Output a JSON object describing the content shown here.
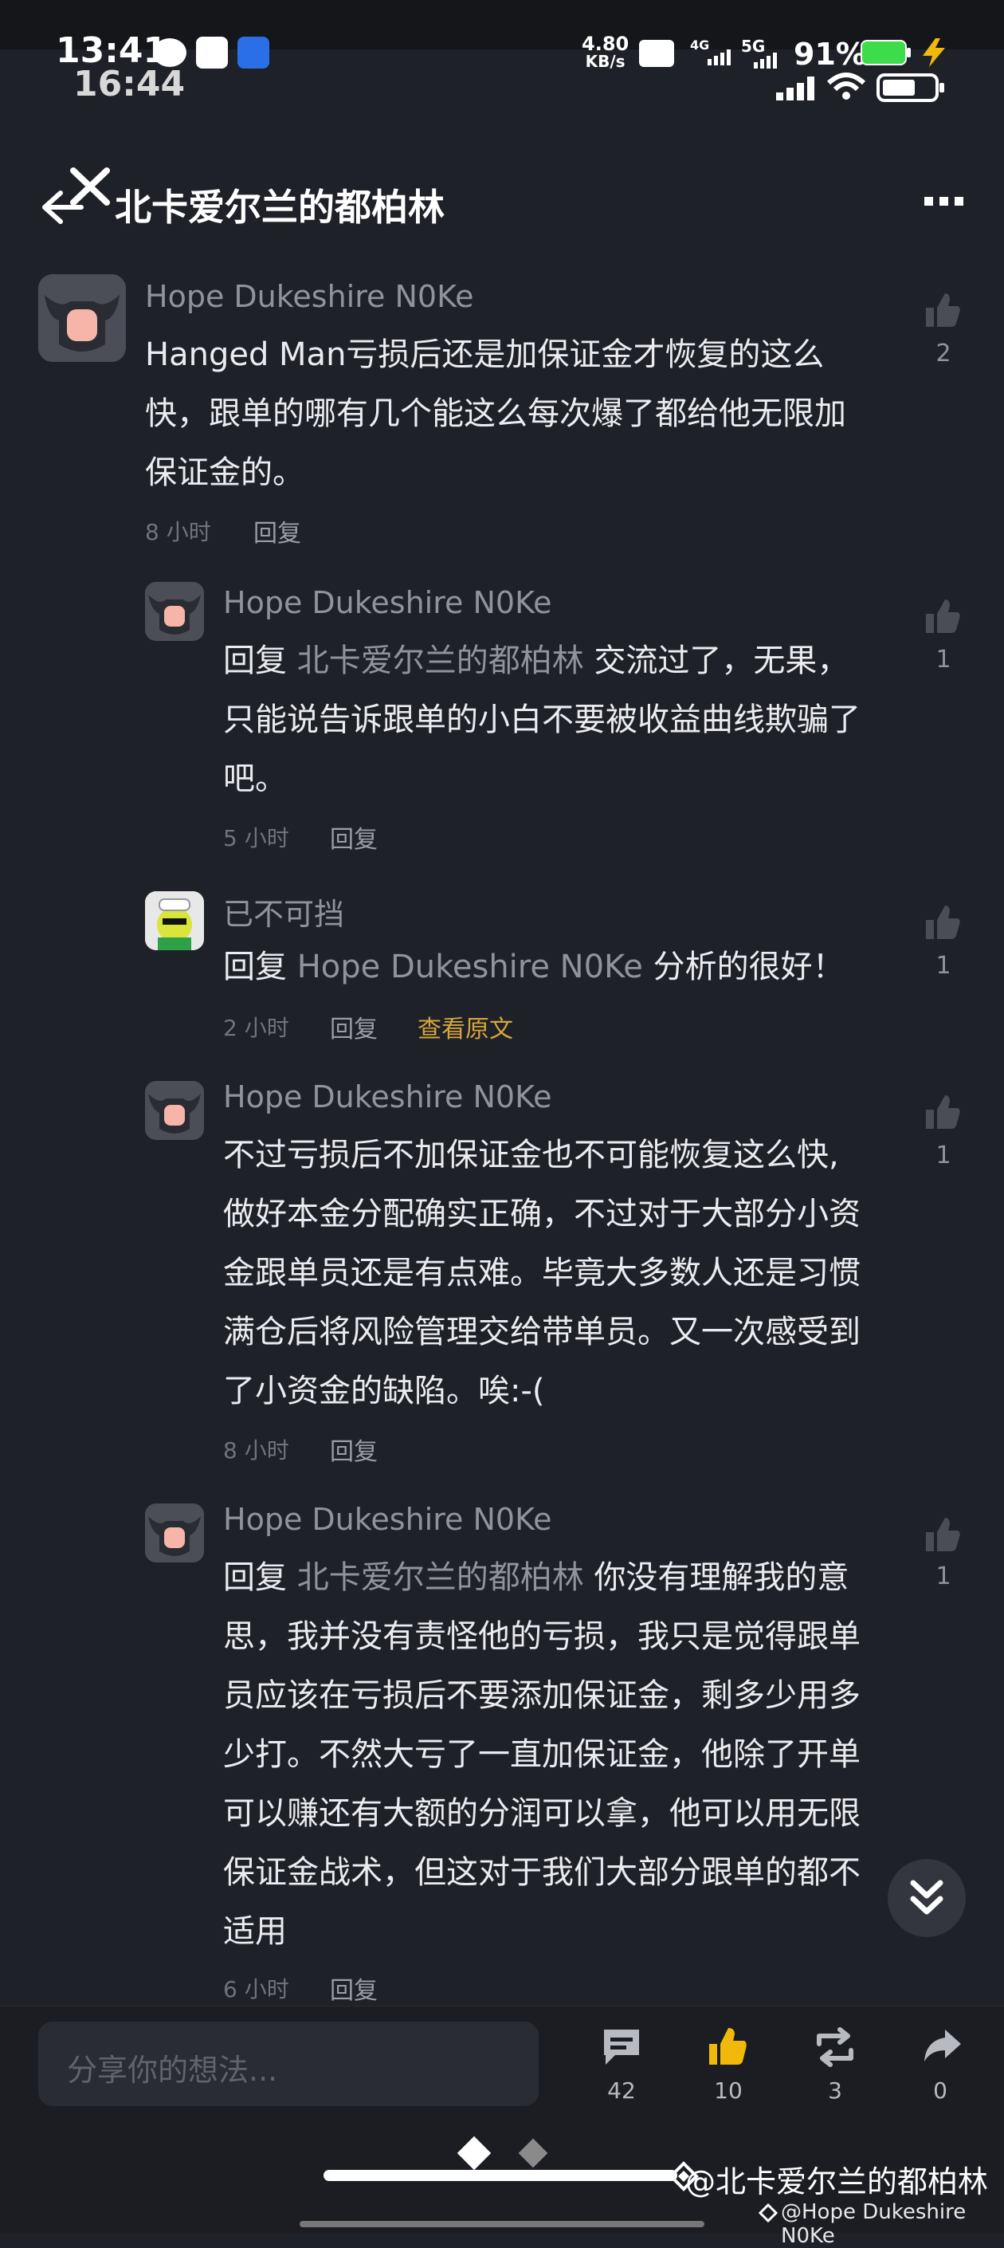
{
  "status_bar": {
    "time": "13:41",
    "network_speed": "4.80",
    "network_unit": "KB/s",
    "signal": "5G",
    "battery": "91%",
    "inner_time": "16:44"
  },
  "header": {
    "title": "北卡爱尔兰的都柏林"
  },
  "comments": [
    {
      "name": "Hope Dukeshire N0Ke",
      "lines": [
        "Hanged Man亏损后还是加保证金才恢复的这么",
        "快，跟单的哪有几个能这么每次爆了都给他无限加",
        "保证金的。"
      ],
      "time": "8 小时",
      "reply": "回复",
      "likes": "2"
    },
    {
      "name": "Hope Dukeshire N0Ke",
      "reply_prefix": "回复",
      "reply_to": "北卡爱尔兰的都柏林",
      "first_rest": "交流过了，无果，",
      "lines": [
        "只能说告诉跟单的小白不要被收益曲线欺骗了",
        "吧。"
      ],
      "time": "5 小时",
      "reply": "回复",
      "likes": "1"
    },
    {
      "name": "已不可挡",
      "reply_prefix": "回复",
      "reply_to": "Hope Dukeshire N0Ke",
      "first_rest": "分析的很好！",
      "lines": [],
      "time": "2 小时",
      "reply": "回复",
      "view_original": "查看原文",
      "likes": "1"
    },
    {
      "name": "Hope Dukeshire N0Ke",
      "lines": [
        "不过亏损后不加保证金也不可能恢复这么快,",
        "做好本金分配确实正确，不过对于大部分小资",
        "金跟单员还是有点难。毕竟大多数人还是习惯",
        "满仓后将风险管理交给带单员。又一次感受到",
        "了小资金的缺陷。唉:-("
      ],
      "time": "8 小时",
      "reply": "回复",
      "likes": "1"
    },
    {
      "name": "Hope Dukeshire N0Ke",
      "reply_prefix": "回复",
      "reply_to": "北卡爱尔兰的都柏林",
      "first_rest": "你没有理解我的意",
      "lines": [
        "思，我并没有责怪他的亏损，我只是觉得跟单",
        "员应该在亏损后不要添加保证金，剩多少用多",
        "少打。不然大亏了一直加保证金，他除了开单",
        "可以赚还有大额的分润可以拿，他可以用无限",
        "保证金战术，但这对于我们大部分跟单的都不",
        "适用"
      ],
      "time": "6 小时",
      "reply": "回复",
      "likes": "1"
    }
  ],
  "bottom_bar": {
    "input_placeholder": "分享你的想法...",
    "comments_count": "42",
    "likes_count": "10",
    "reposts_count": "3",
    "shares_count": "0"
  },
  "watermark": {
    "main": "@北卡爱尔兰的都柏林",
    "sub": "@Hope Dukeshire N0Ke"
  },
  "colors": {
    "background": "#1f2128",
    "accent_gold": "#d6a53a",
    "like_active": "#f0b90b"
  }
}
